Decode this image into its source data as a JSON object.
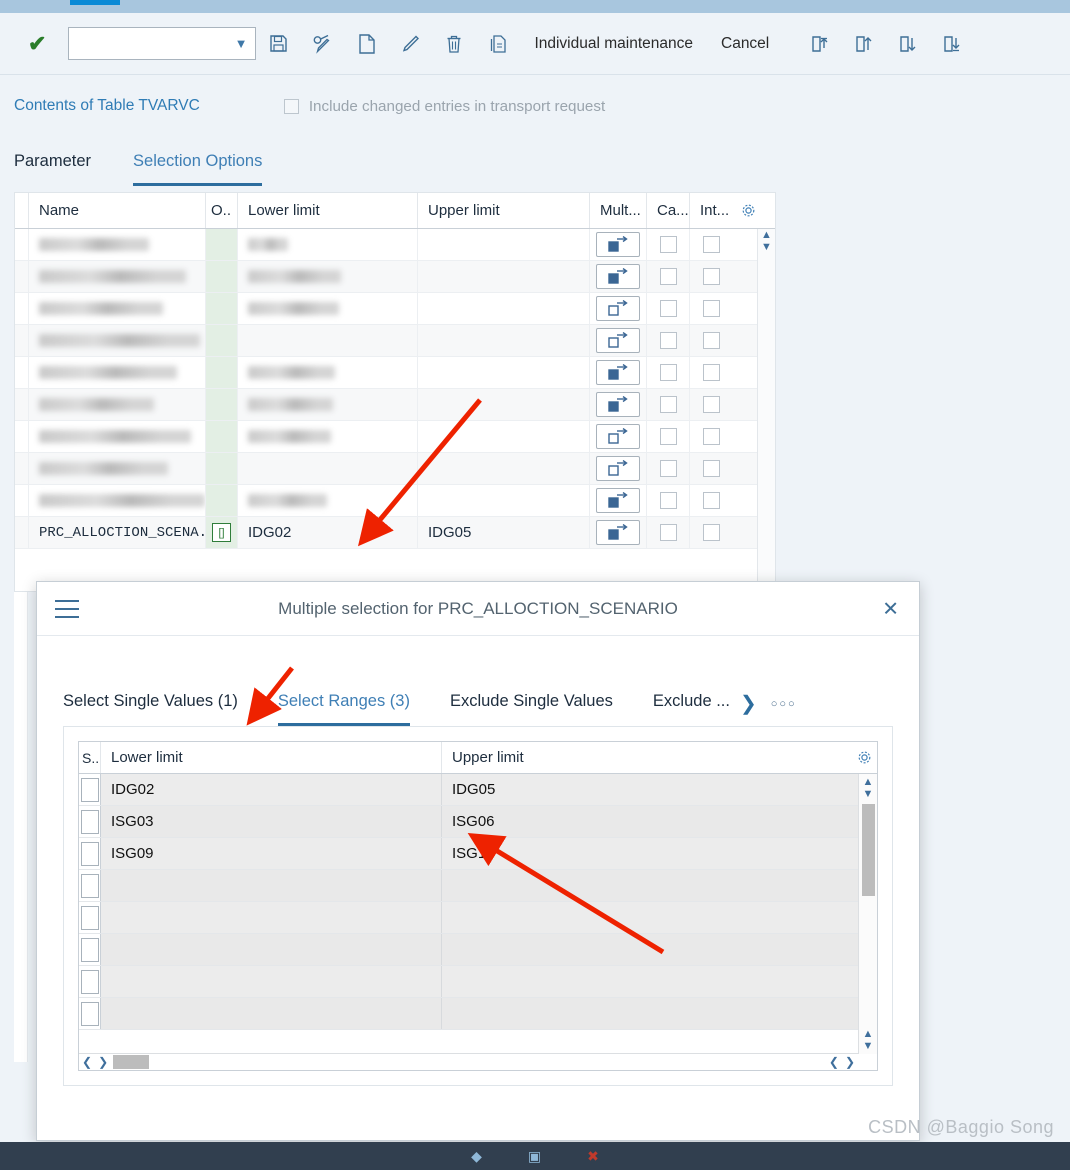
{
  "toolbar": {
    "confirm_icon": "green-check-icon",
    "combo_value": "",
    "combo_placeholder": "",
    "icons": [
      {
        "name": "save-icon",
        "title": "Save"
      },
      {
        "name": "display-change-icon",
        "title": "Display/Change"
      },
      {
        "name": "new-entry-icon",
        "title": "New Entries"
      },
      {
        "name": "edit-icon",
        "title": "Edit"
      },
      {
        "name": "delete-icon",
        "title": "Delete"
      },
      {
        "name": "copy-icon",
        "title": "Copy"
      }
    ],
    "individual_maintenance_label": "Individual maintenance",
    "cancel_label": "Cancel",
    "nav_icons": [
      {
        "name": "first-page-icon"
      },
      {
        "name": "previous-page-icon"
      },
      {
        "name": "next-page-icon"
      },
      {
        "name": "last-page-icon"
      }
    ]
  },
  "subheader": {
    "table_link": "Contents of Table TVARVC",
    "transport_checkbox_label": "Include changed entries in transport request",
    "transport_checked": false
  },
  "tabs": [
    {
      "label": "Parameter",
      "active": false
    },
    {
      "label": "Selection Options",
      "active": true
    }
  ],
  "main_table": {
    "columns": [
      "Name",
      "O..",
      "Lower limit",
      "Upper limit",
      "Mult...",
      "Ca...",
      "Int..."
    ],
    "gear_icon": "settings-gear-icon",
    "rows": [
      {
        "name": "",
        "op": "",
        "lower": "",
        "upper": "",
        "mult": "filled",
        "redacted": true
      },
      {
        "name": "",
        "op": "",
        "lower": "",
        "upper": "",
        "mult": "filled",
        "redacted": true
      },
      {
        "name": "",
        "op": "",
        "lower": "",
        "upper": "",
        "mult": "hollow",
        "redacted": true
      },
      {
        "name": "",
        "op": "",
        "lower": "",
        "upper": "",
        "mult": "hollow",
        "redacted": true
      },
      {
        "name": "",
        "op": "",
        "lower": "",
        "upper": "",
        "mult": "filled",
        "redacted": true
      },
      {
        "name": "",
        "op": "",
        "lower": "",
        "upper": "",
        "mult": "filled",
        "redacted": true
      },
      {
        "name": "",
        "op": "",
        "lower": "",
        "upper": "",
        "mult": "hollow",
        "redacted": true
      },
      {
        "name": "",
        "op": "",
        "lower": "",
        "upper": "",
        "mult": "hollow",
        "redacted": true
      },
      {
        "name": "",
        "op": "",
        "lower": "",
        "upper": "",
        "mult": "filled",
        "redacted": true
      },
      {
        "name": "PRC_ALLOCTION_SCENA...",
        "op": "[]",
        "lower": "IDG02",
        "upper": "IDG05",
        "mult": "filled",
        "redacted": false
      }
    ]
  },
  "dialog": {
    "title": "Multiple selection for PRC_ALLOCTION_SCENARIO",
    "menu_icon": "hamburger-menu-icon",
    "close_icon": "close-icon",
    "tabs": [
      {
        "label": "Select Single Values (1)",
        "active": false
      },
      {
        "label": "Select Ranges (3)",
        "active": true
      },
      {
        "label": "Exclude Single Values",
        "active": false
      },
      {
        "label": "Exclude ...",
        "active": false
      }
    ],
    "tab_next_icon": "chevron-right-icon",
    "tab_overflow_icon": "overflow-dots-icon",
    "table": {
      "columns": [
        "S..",
        "Lower limit",
        "Upper limit"
      ],
      "gear_icon": "settings-gear-icon",
      "rows": [
        {
          "lower": "IDG02",
          "upper": "IDG05"
        },
        {
          "lower": "ISG03",
          "upper": "ISG06"
        },
        {
          "lower": "ISG09",
          "upper": "ISG10"
        },
        {
          "lower": "",
          "upper": ""
        },
        {
          "lower": "",
          "upper": ""
        },
        {
          "lower": "",
          "upper": ""
        },
        {
          "lower": "",
          "upper": ""
        },
        {
          "lower": "",
          "upper": ""
        }
      ]
    },
    "hscroll": {
      "left_icon": "scroll-left-icon",
      "right_icon": "scroll-right-icon"
    },
    "vscroll": {
      "up_icon": "scroll-up-icon",
      "down_icon": "scroll-down-icon"
    }
  },
  "footer": {
    "icons": [
      {
        "name": "footer-marker-icon"
      },
      {
        "name": "footer-save-icon"
      },
      {
        "name": "footer-cancel-icon"
      }
    ]
  },
  "watermark": "CSDN @Baggio Song",
  "colors": {
    "accent_blue": "#3f7fb5",
    "tab_underline": "#2d6d9e",
    "header_bg": "#eef3f8",
    "operator_green": "#e3efe4",
    "footer_dark": "#313f4f",
    "arrow_red": "#ee2200"
  }
}
